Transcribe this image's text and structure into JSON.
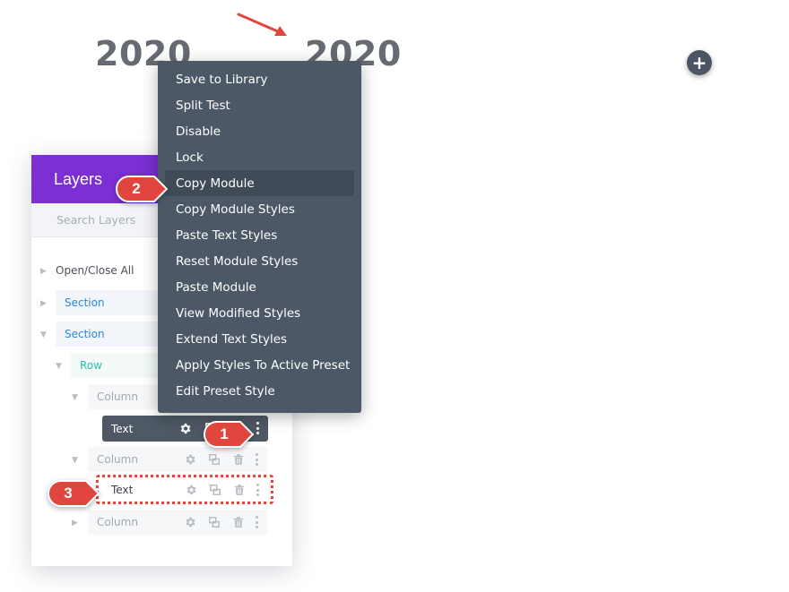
{
  "canvas": {
    "heading_left": "2020",
    "heading_right": "2020",
    "add_button_label": "+"
  },
  "layers": {
    "title": "Layers",
    "search_placeholder": "Search Layers",
    "open_close": "Open/Close All",
    "section_1": "Section",
    "section_2": "Section",
    "row": "Row",
    "column_1": "Column",
    "text_1": "Text",
    "column_2": "Column",
    "text_2": "Text",
    "column_3": "Column"
  },
  "context_menu": {
    "items": [
      "Save to Library",
      "Split Test",
      "Disable",
      "Lock",
      "Copy Module",
      "Copy Module Styles",
      "Paste Text Styles",
      "Reset Module Styles",
      "Paste Module",
      "View Modified Styles",
      "Extend Text Styles",
      "Apply Styles To Active Preset",
      "Edit Preset Style"
    ],
    "highlighted_index": 4
  },
  "steps": {
    "step_1": "1",
    "step_2": "2",
    "step_3": "3"
  },
  "colors": {
    "layers_header": "#7c2fd4",
    "menu_bg": "#4c5866",
    "badge": "#e0463e",
    "section": "#2b87da",
    "row": "#29c4a9"
  },
  "icons": {
    "settings": "gear-icon",
    "duplicate": "duplicate-icon",
    "delete": "trash-icon",
    "more": "kebab-menu-icon",
    "add": "plus-icon",
    "arrow": "annotation-arrow-icon"
  }
}
